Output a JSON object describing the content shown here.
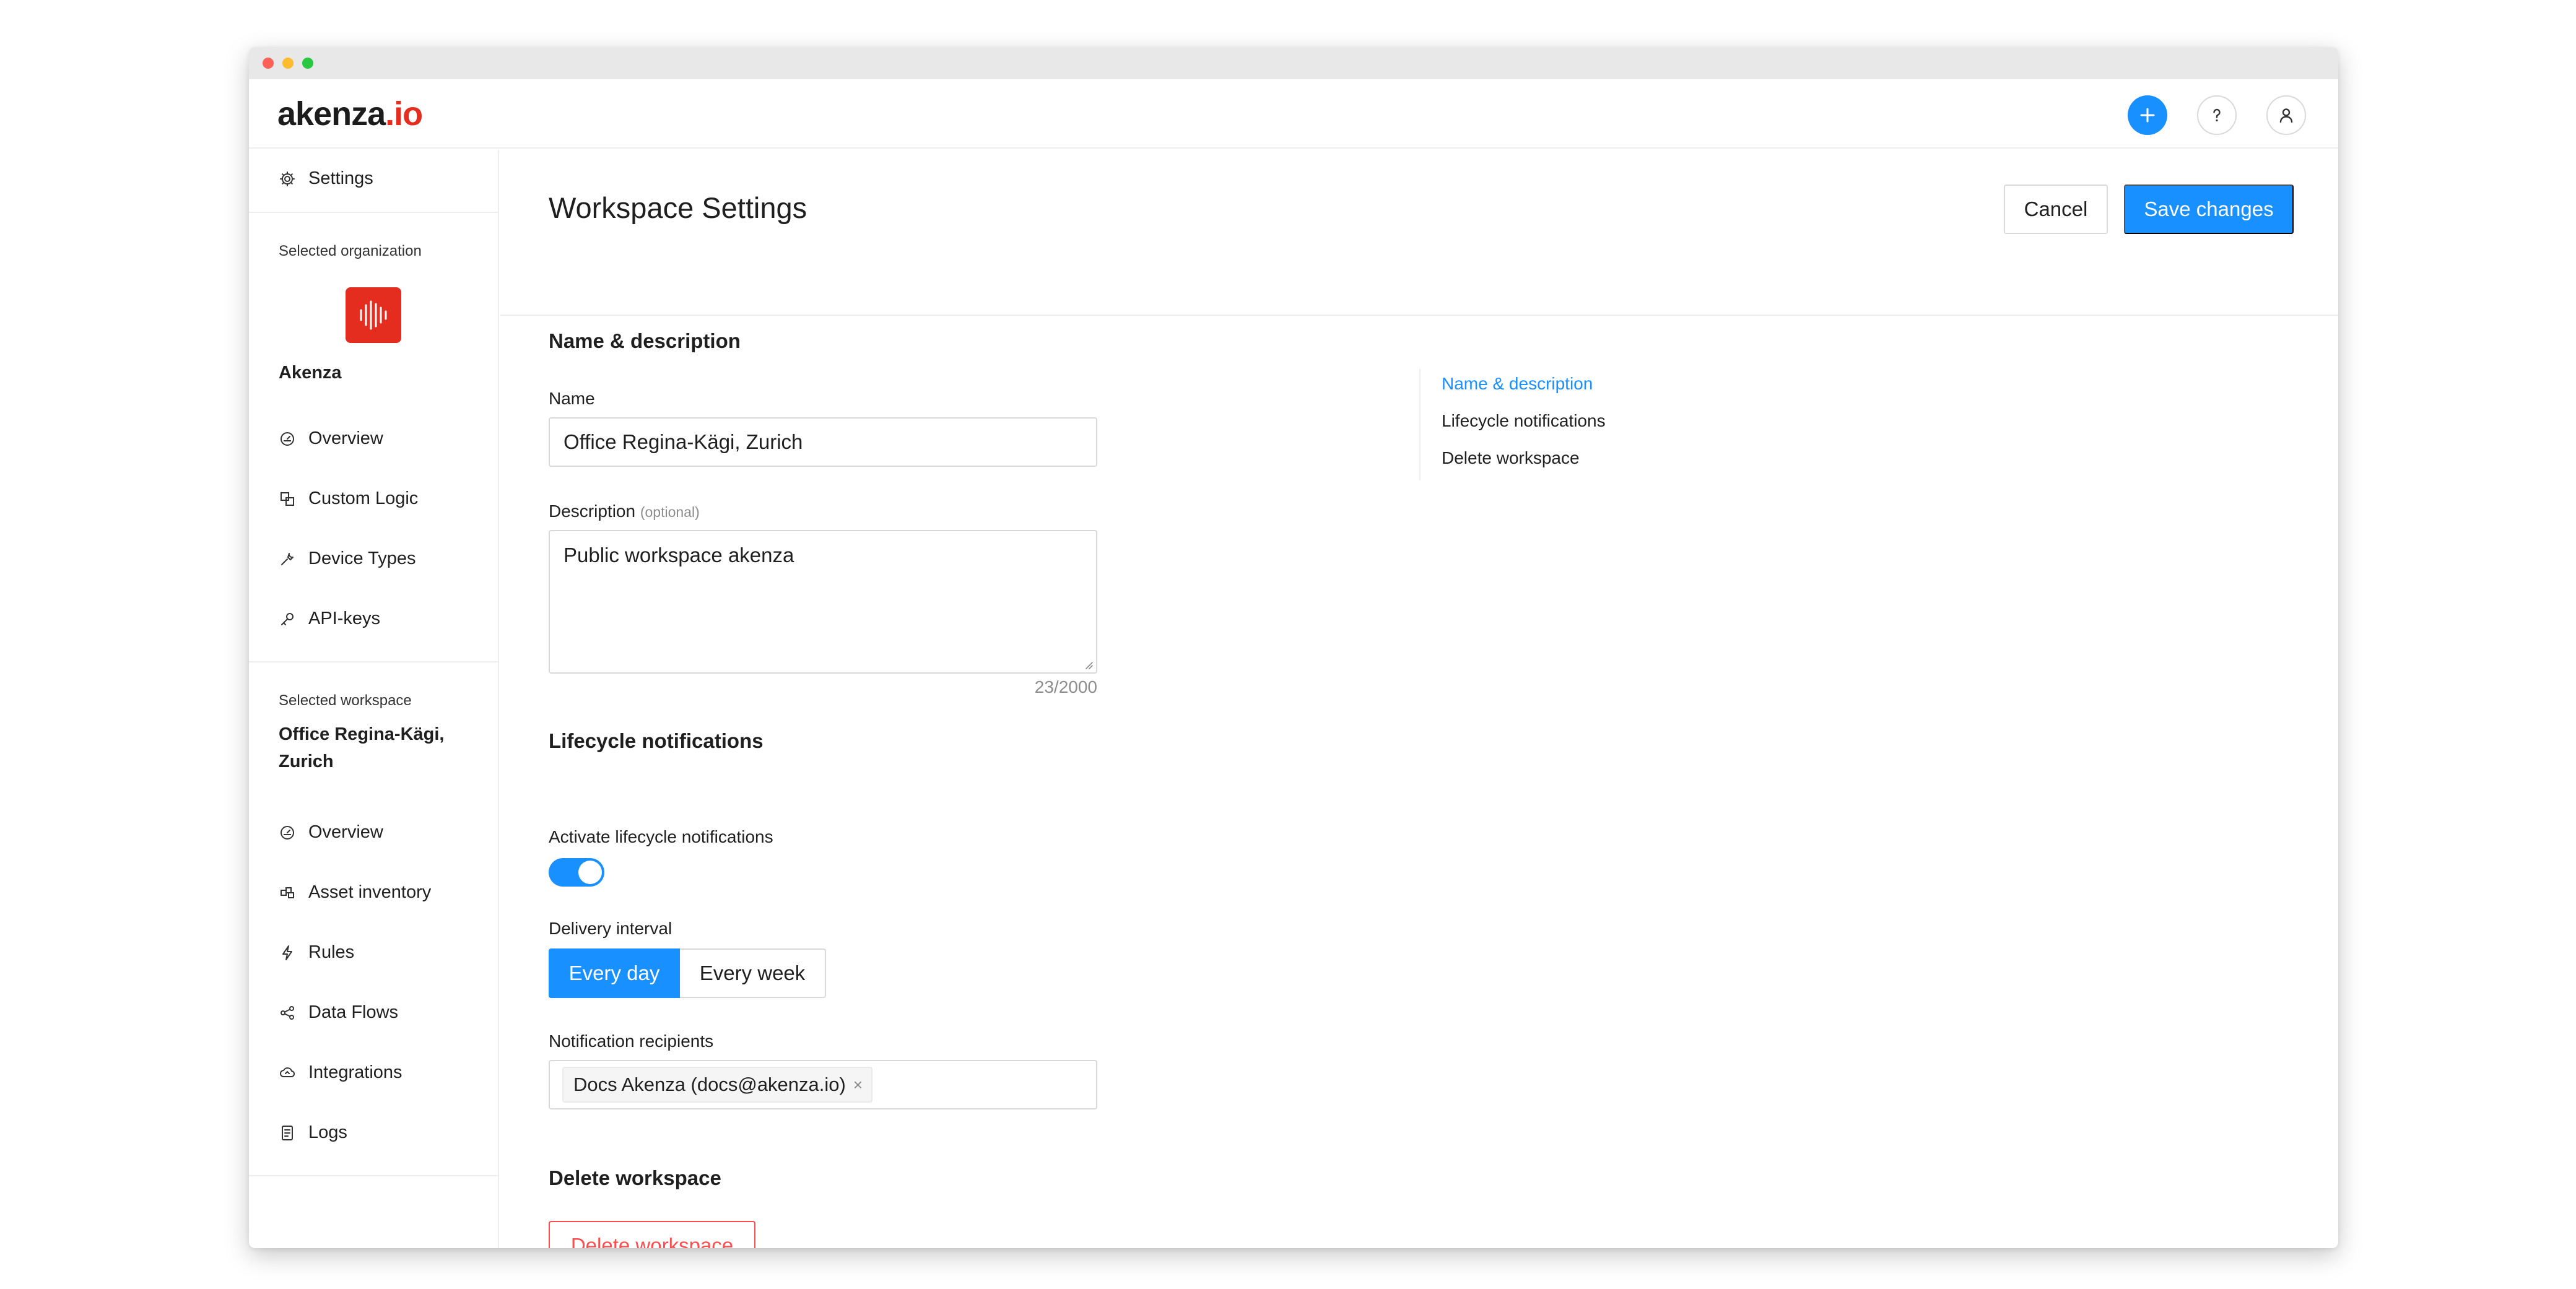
{
  "app": {
    "logo_main": "akenza",
    "logo_suffix": ".io"
  },
  "sidebar": {
    "settings_label": "Settings",
    "org_caption": "Selected organization",
    "org_name": "Akenza",
    "org_items": [
      {
        "label": "Overview",
        "icon": "dashboard-icon"
      },
      {
        "label": "Custom Logic",
        "icon": "custom-logic-icon"
      },
      {
        "label": "Device Types",
        "icon": "wrench-icon"
      },
      {
        "label": "API-keys",
        "icon": "key-icon"
      }
    ],
    "ws_caption": "Selected workspace",
    "ws_name_line1": "Office Regina-Kägi,",
    "ws_name_line2": "Zurich",
    "ws_items": [
      {
        "label": "Overview",
        "icon": "dashboard-icon"
      },
      {
        "label": "Asset inventory",
        "icon": "asset-inventory-icon"
      },
      {
        "label": "Rules",
        "icon": "lightning-icon"
      },
      {
        "label": "Data Flows",
        "icon": "share-nodes-icon"
      },
      {
        "label": "Integrations",
        "icon": "cloud-sync-icon"
      },
      {
        "label": "Logs",
        "icon": "logs-icon"
      }
    ]
  },
  "main": {
    "title": "Workspace Settings",
    "cancel_label": "Cancel",
    "save_label": "Save changes",
    "name_section_title": "Name & description",
    "name_label": "Name",
    "name_value": "Office Regina-Kägi, Zurich",
    "description_label": "Description",
    "description_optional": "(optional)",
    "description_value": "Public workspace akenza",
    "description_counter": "23/2000",
    "lifecycle_section_title": "Lifecycle notifications",
    "activate_label": "Activate lifecycle notifications",
    "activate_on": true,
    "interval_label": "Delivery interval",
    "interval_options": [
      "Every day",
      "Every week"
    ],
    "interval_selected": "Every day",
    "recipients_label": "Notification recipients",
    "recipients": [
      "Docs Akenza (docs@akenza.io)"
    ],
    "recipient_remove_glyph": "×",
    "delete_section_title": "Delete workspace",
    "delete_button_label": "Delete workspace"
  },
  "anchor_nav": {
    "links": [
      "Name & description",
      "Lifecycle notifications",
      "Delete workspace"
    ],
    "active": "Name & description"
  },
  "colors": {
    "primary": "#1890ff",
    "brand_red": "#e52d1f",
    "danger": "#ff4d4f"
  }
}
